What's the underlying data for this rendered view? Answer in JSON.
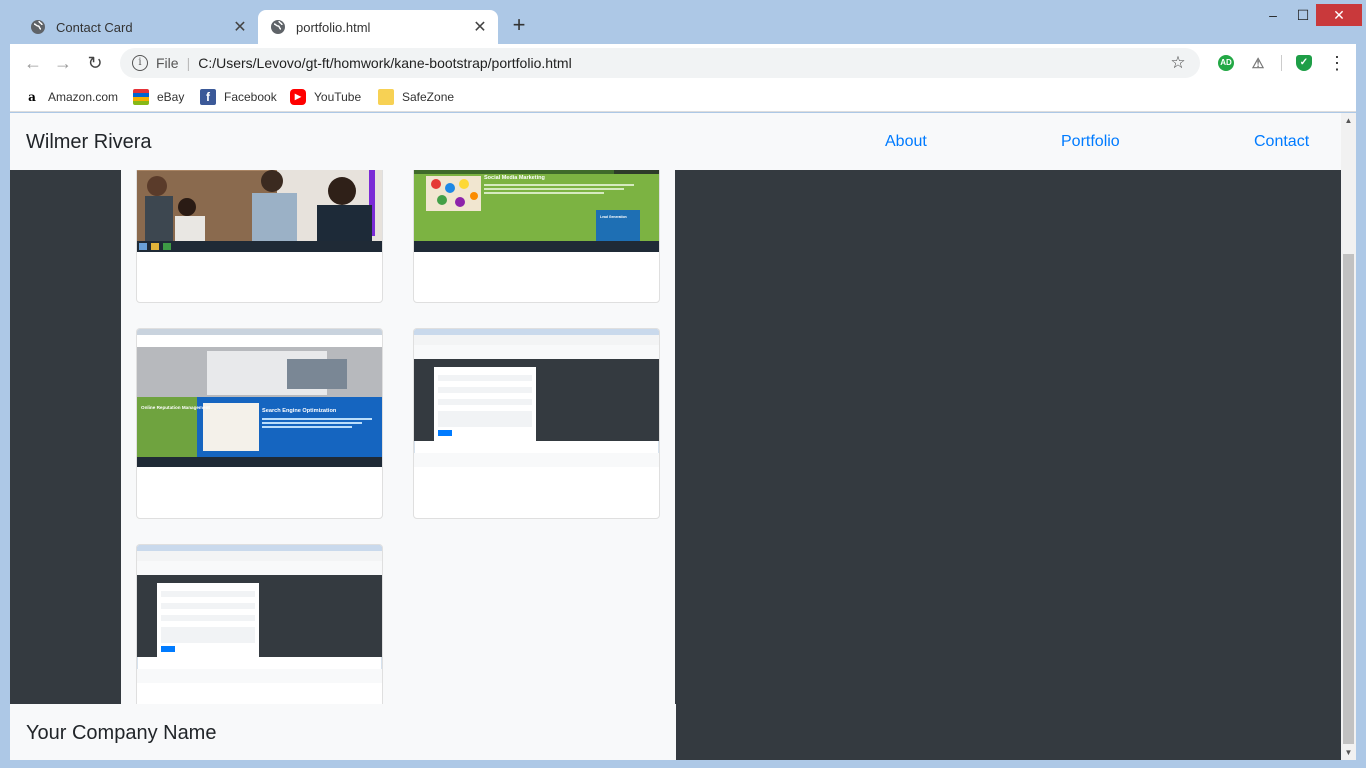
{
  "browser": {
    "tabs": [
      {
        "label": "Contact Card",
        "active": false
      },
      {
        "label": "portfolio.html",
        "active": true
      }
    ],
    "new_tab_icon": "plus-icon",
    "window_controls": {
      "minimize": "–",
      "maximize": "☐",
      "close": "✕"
    },
    "address": {
      "scheme": "File",
      "url": "C:/Users/Levovo/gt-ft/homwork/kane-bootstrap/portfolio.html"
    },
    "extensions": {
      "adblock": "AD"
    },
    "bookmarks": [
      {
        "label": "Amazon.com",
        "icon": "amazon-icon"
      },
      {
        "label": "eBay",
        "icon": "ebay-icon"
      },
      {
        "label": "Facebook",
        "icon": "facebook-icon"
      },
      {
        "label": "YouTube",
        "icon": "youtube-icon"
      },
      {
        "label": "SafeZone",
        "icon": "folder-icon"
      }
    ]
  },
  "page": {
    "brand": "Wilmer Rivera",
    "nav": {
      "about": "About",
      "portfolio": "Portfolio",
      "contact": "Contact"
    },
    "footer": "Your Company Name",
    "cards": [
      {
        "screenshot": {
          "heading": "",
          "kind": "office-photo"
        }
      },
      {
        "screenshot": {
          "heading": "Social Media Marketing",
          "badge": "Lead Generation",
          "kind": "marketing-green"
        }
      },
      {
        "screenshot": {
          "heading": "Search Engine Optimization",
          "side": "Online Reputation Management",
          "kind": "seo-blue"
        }
      },
      {
        "screenshot": {
          "heading": "",
          "kind": "contact-form"
        }
      },
      {
        "screenshot": {
          "heading": "",
          "kind": "contact-form"
        }
      }
    ]
  },
  "colors": {
    "navbar_bg": "#f8f9fa",
    "body_bg": "#343a40",
    "link": "#007bff",
    "chrome_frame": "#adc8e6",
    "close_button": "#c9393b"
  }
}
